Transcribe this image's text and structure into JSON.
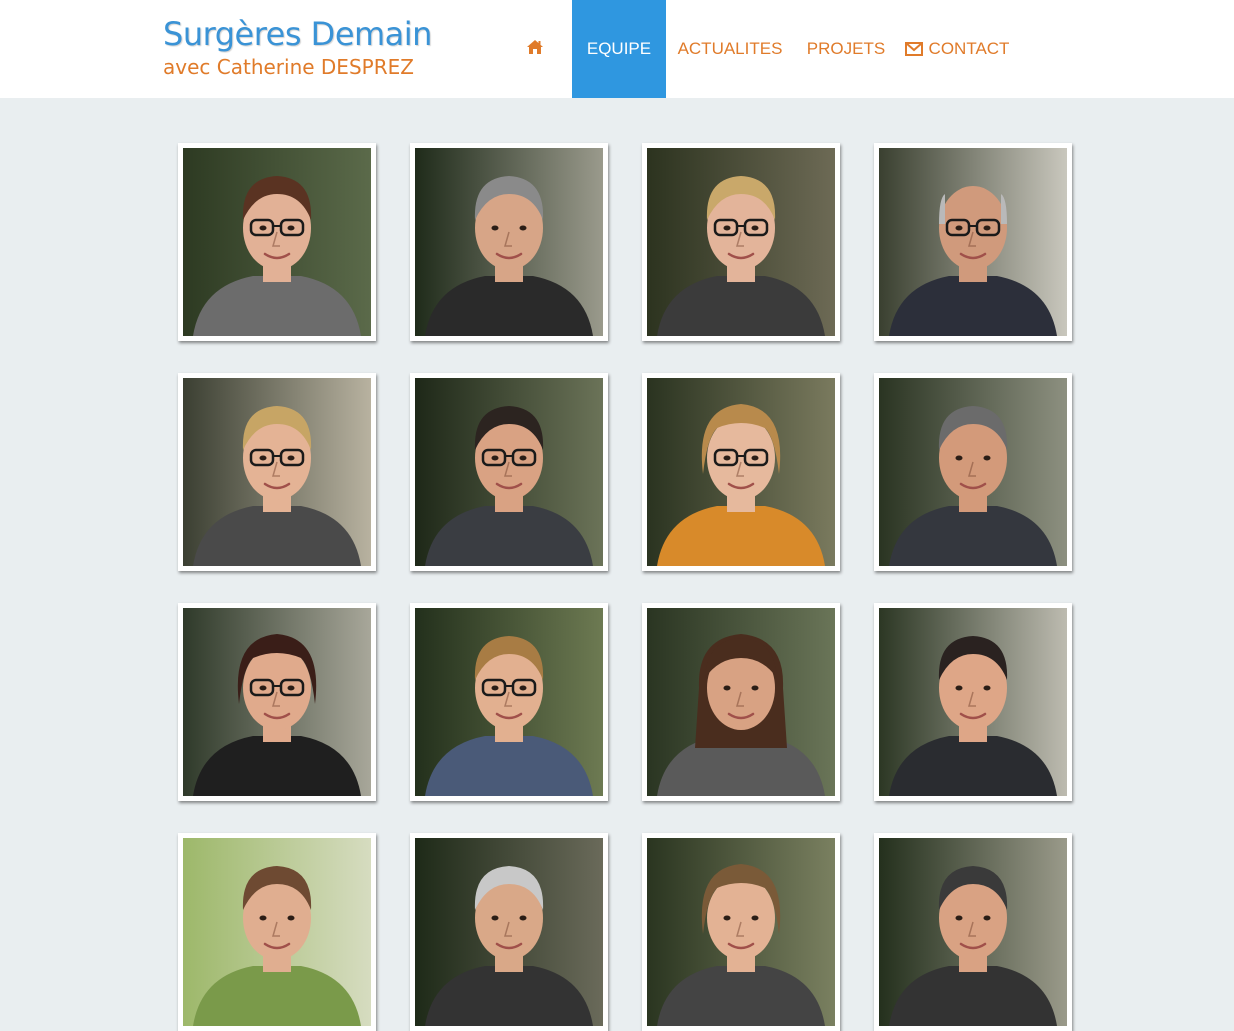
{
  "site": {
    "title": "Surgères Demain",
    "subtitle": "avec Catherine DESPREZ"
  },
  "nav": {
    "home_icon": "home-icon",
    "items": [
      {
        "label": "EQUIPE",
        "active": true
      },
      {
        "label": "ACTUALITES",
        "active": false
      },
      {
        "label": "PROJETS",
        "active": false
      },
      {
        "label": "CONTACT",
        "active": false,
        "icon": "envelope-icon"
      }
    ]
  },
  "colors": {
    "brand_blue": "#3a93d6",
    "brand_orange": "#e07b2a",
    "active_tab": "#2f97e0",
    "page_bg": "#e9eef0"
  },
  "team": [
    {
      "skin": "#e2b196",
      "hair": "#5a3322",
      "hairStyle": "short",
      "clothes": "#6c6c6c",
      "glasses": true,
      "bg": "#2d3a22",
      "bgLight": "#5b6a4a"
    },
    {
      "skin": "#d7a587",
      "hair": "#8a8a8a",
      "hairStyle": "short",
      "clothes": "#2a2a2a",
      "glasses": false,
      "bg": "#1f2b1a",
      "bgLight": "#9a9a8c"
    },
    {
      "skin": "#e3b49a",
      "hair": "#c9a86a",
      "hairStyle": "short",
      "clothes": "#3b3b3b",
      "glasses": true,
      "bg": "#2c331f",
      "bgLight": "#6d6a55"
    },
    {
      "skin": "#d09a7c",
      "hair": "#b9b9b9",
      "hairStyle": "bald",
      "clothes": "#2c2f3a",
      "glasses": true,
      "bg": "#3a4030",
      "bgLight": "#c9c7bd"
    },
    {
      "skin": "#e4b395",
      "hair": "#c7a565",
      "hairStyle": "short",
      "clothes": "#4a4a4a",
      "glasses": true,
      "bg": "#3b3f32",
      "bgLight": "#b8b2a0"
    },
    {
      "skin": "#d9a283",
      "hair": "#2c2420",
      "hairStyle": "short",
      "clothes": "#3a3d42",
      "glasses": true,
      "bg": "#1e2818",
      "bgLight": "#6b7358"
    },
    {
      "skin": "#e6b99d",
      "hair": "#b88a4c",
      "hairStyle": "bob",
      "clothes": "#d88a2a",
      "glasses": true,
      "bg": "#2a3320",
      "bgLight": "#7a7a5e"
    },
    {
      "skin": "#d39a7a",
      "hair": "#6b6b6b",
      "hairStyle": "short",
      "clothes": "#34373e",
      "glasses": false,
      "bg": "#2a3422",
      "bgLight": "#8d9080"
    },
    {
      "skin": "#e0aa8c",
      "hair": "#3a1e18",
      "hairStyle": "bob",
      "clothes": "#1f1f1f",
      "glasses": true,
      "bg": "#2f3a2a",
      "bgLight": "#a8a79a"
    },
    {
      "skin": "#e2b090",
      "hair": "#a87c44",
      "hairStyle": "short",
      "clothes": "#4a5a78",
      "glasses": true,
      "bg": "#23301c",
      "bgLight": "#6d7a52"
    },
    {
      "skin": "#d8a283",
      "hair": "#4a2d1e",
      "hairStyle": "long",
      "clothes": "#5a5a5a",
      "glasses": false,
      "bg": "#2a3522",
      "bgLight": "#6a7558"
    },
    {
      "skin": "#dea687",
      "hair": "#2a2220",
      "hairStyle": "short",
      "clothes": "#2a2c30",
      "glasses": false,
      "bg": "#2c3724",
      "bgLight": "#bdbbb0"
    },
    {
      "skin": "#e0ae90",
      "hair": "#6e4a32",
      "hairStyle": "short",
      "clothes": "#7a9a4a",
      "glasses": false,
      "bg": "#9db86a",
      "bgLight": "#d6dcc0"
    },
    {
      "skin": "#d9a888",
      "hair": "#c8c8c8",
      "hairStyle": "short",
      "clothes": "#333333",
      "glasses": false,
      "bg": "#1e2a18",
      "bgLight": "#6a6a5a"
    },
    {
      "skin": "#e3b294",
      "hair": "#7a5a38",
      "hairStyle": "bob",
      "clothes": "#444444",
      "glasses": false,
      "bg": "#2a3520",
      "bgLight": "#7a8060"
    },
    {
      "skin": "#d9a283",
      "hair": "#3a3a3a",
      "hairStyle": "short",
      "clothes": "#333333",
      "glasses": false,
      "bg": "#24301d",
      "bgLight": "#9a9a8a"
    }
  ]
}
